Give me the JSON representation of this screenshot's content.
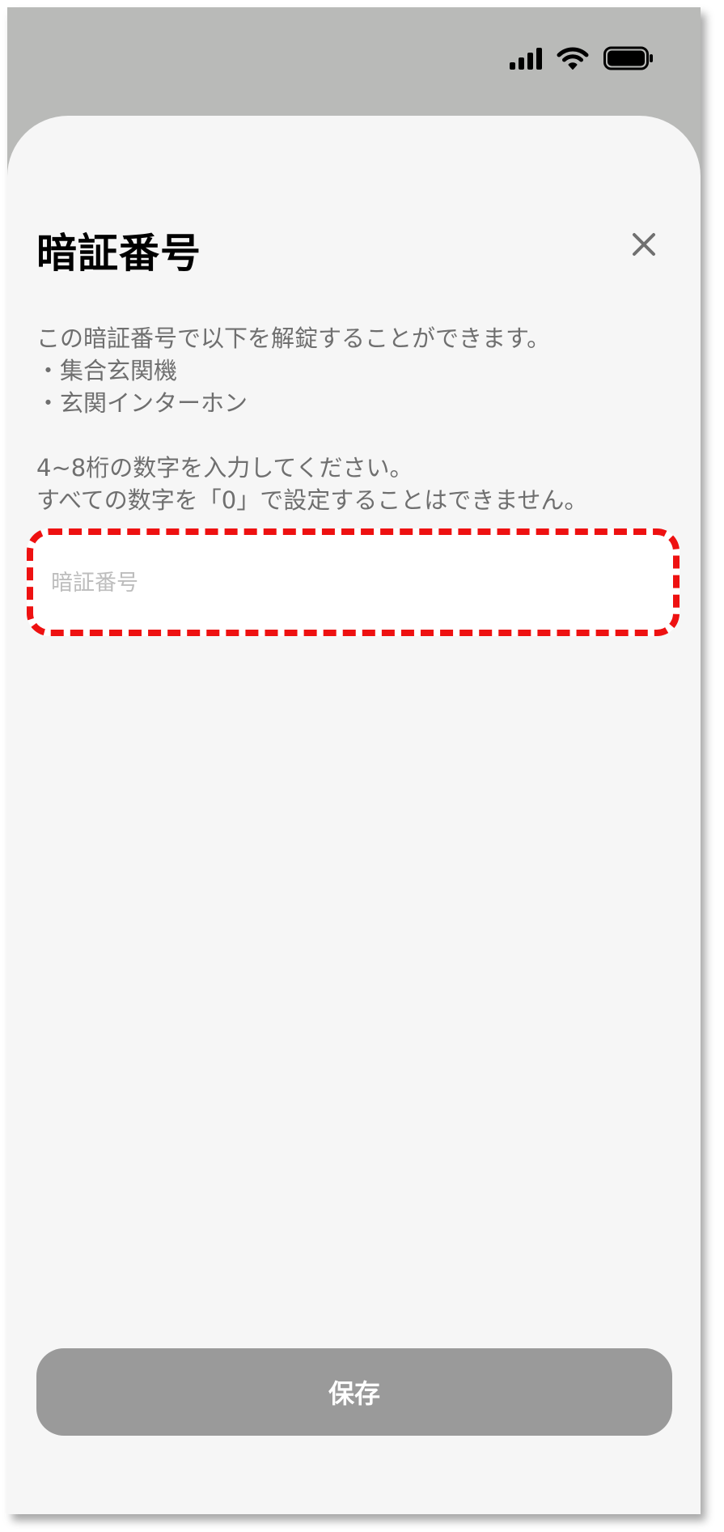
{
  "status_bar": {
    "signal_icon": "cellular-signal-icon",
    "wifi_icon": "wifi-icon",
    "battery_icon": "battery-icon"
  },
  "modal": {
    "title": "暗証番号",
    "close_icon": "close-icon",
    "description_lines": [
      "この暗証番号で以下を解錠することができます。",
      "・集合玄関機",
      "・玄関インターホン"
    ],
    "instruction_lines": [
      "4~8桁の数字を入力してください。",
      "すべての数字を「0」で設定することはできません。"
    ],
    "pin_input": {
      "value": "",
      "placeholder": "暗証番号"
    },
    "save_label": "保存"
  },
  "colors": {
    "highlight": "#ee1111",
    "button_disabled": "#9a9a9a",
    "sheet_bg": "#f6f6f6"
  }
}
